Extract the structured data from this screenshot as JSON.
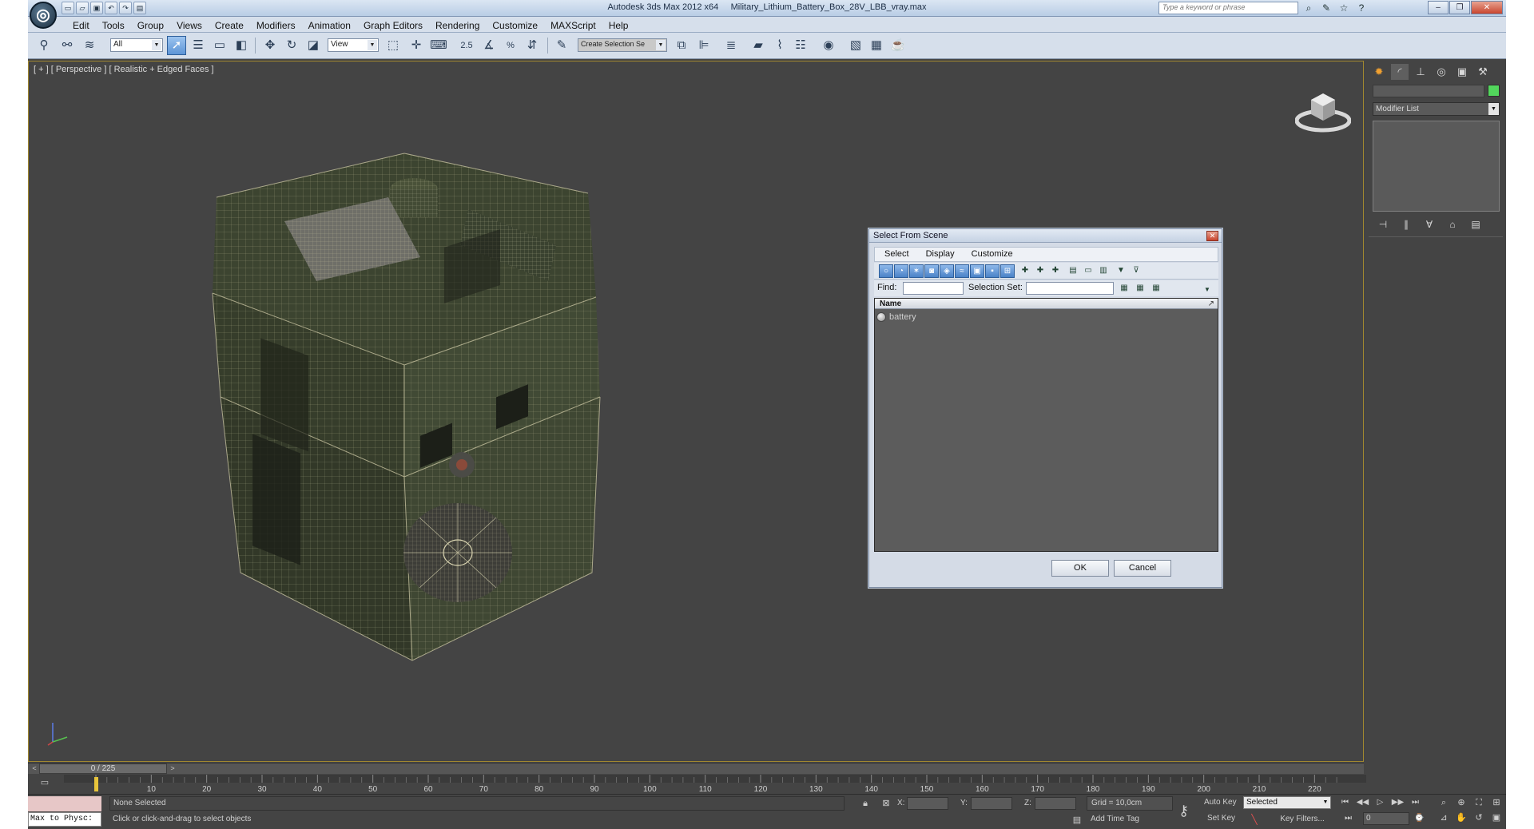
{
  "titlebar": {
    "app_name": "Autodesk 3ds Max  2012 x64",
    "file_name": "Military_Lithium_Battery_Box_28V_LBB_vray.max",
    "search_placeholder": "Type a keyword or phrase",
    "logo_icon": "3ds-max-logo-icon",
    "qa_icons": [
      "new-file-icon",
      "open-file-icon",
      "save-file-icon",
      "undo-icon",
      "redo-icon",
      "project-folder-icon"
    ],
    "info_icons": [
      "binoculars-icon",
      "communication-center-icon",
      "favorites-star-icon",
      "help-icon"
    ]
  },
  "menubar": {
    "items": [
      "Edit",
      "Tools",
      "Group",
      "Views",
      "Create",
      "Modifiers",
      "Animation",
      "Graph Editors",
      "Rendering",
      "Customize",
      "MAXScript",
      "Help"
    ]
  },
  "main_toolbar": {
    "selection_filter": "All",
    "reference_coord": "View",
    "named_selection_set": "Create Selection Se",
    "snap_labels": [
      "2.5",
      "%"
    ]
  },
  "viewport": {
    "label": "[ + ] [ Perspective ] [ Realistic + Edged Faces ]",
    "model_name": "battery",
    "model_color": "#3c4430",
    "wire_color": "#c7c29a"
  },
  "dialog": {
    "title": "Select From Scene",
    "menu": [
      "Select",
      "Display",
      "Customize"
    ],
    "find_label": "Find:",
    "selection_set_label": "Selection Set:",
    "column_header": "Name",
    "sort_indicator": "↗",
    "items": [
      {
        "name": "battery",
        "icon": "geometry-sphere-icon"
      }
    ],
    "ok_label": "OK",
    "cancel_label": "Cancel"
  },
  "command_panel": {
    "tabs": [
      "create-tab-icon",
      "modify-tab-icon",
      "hierarchy-tab-icon",
      "motion-tab-icon",
      "display-tab-icon",
      "utilities-tab-icon"
    ],
    "modifier_list_label": "Modifier List",
    "object_color": "#52d65c"
  },
  "time_slider": {
    "position": "0 / 225",
    "prev": "<",
    "next": ">",
    "frame_labels": [
      "10",
      "20",
      "30",
      "40",
      "50",
      "60",
      "70",
      "80",
      "90",
      "100",
      "110",
      "120",
      "130",
      "140",
      "150",
      "160",
      "170",
      "180",
      "190",
      "200",
      "210",
      "220"
    ]
  },
  "statusbar": {
    "maxscript_listener": "Max to Physc:",
    "selection_status": "None Selected",
    "prompt": "Click or click-and-drag to select objects",
    "x_label": "X:",
    "y_label": "Y:",
    "z_label": "Z:",
    "grid": "Grid = 10,0cm",
    "add_time_tag": "Add Time Tag",
    "auto_key": "Auto Key",
    "set_key": "Set Key",
    "key_mode": "Selected",
    "key_filters": "Key Filters...",
    "current_frame": "0"
  },
  "colors": {
    "viewport_bg": "#444444",
    "ui_light": "#d6dfeb",
    "active_accent": "#5d95d6",
    "playhead": "#e8c53b"
  }
}
